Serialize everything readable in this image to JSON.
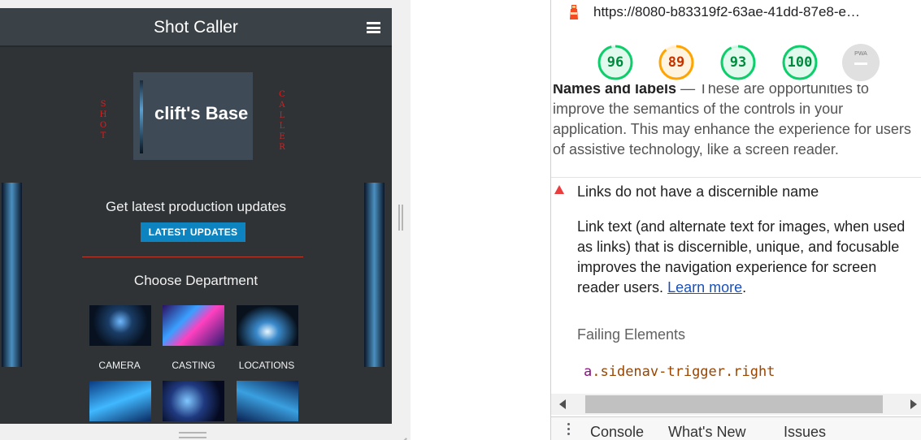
{
  "app": {
    "title": "Shot Caller",
    "vertical_left": [
      "S",
      "H",
      "O",
      "T"
    ],
    "vertical_right": [
      "C",
      "A",
      "L",
      "L",
      "E",
      "R"
    ],
    "base_title": "clift's Base",
    "latest_text": "Get latest production updates",
    "latest_button": "LATEST UPDATES",
    "choose_text": "Choose Department",
    "departments": [
      "CAMERA",
      "CASTING",
      "LOCATIONS"
    ]
  },
  "devtools": {
    "url": "https://8080-b83319f2-63ae-41dd-87e8-e…",
    "scores": [
      {
        "value": "96",
        "color": "#0cce6b",
        "text_color": "#008a3e",
        "fill": 0.96
      },
      {
        "value": "89",
        "color": "#ffa400",
        "text_color": "#c33300",
        "fill": 0.89
      },
      {
        "value": "93",
        "color": "#0cce6b",
        "text_color": "#008a3e",
        "fill": 0.93
      },
      {
        "value": "100",
        "color": "#0cce6b",
        "text_color": "#008a3e",
        "fill": 1.0
      }
    ],
    "pwa_label": "PWA",
    "section_title": "Names and labels",
    "section_rest": " — These are opportunities to improve the semantics of the controls in your application. This may enhance the experience for users of assistive technology, like a screen reader.",
    "audit_title": "Links do not have a discernible name",
    "audit_desc": "Link text (and alternate text for images, when used as links) that is discernible, unique, and focusable improves the navigation experience for screen reader users. ",
    "learn_more": "Learn more",
    "learn_more_suffix": ".",
    "failing_label": "Failing Elements",
    "failing_tag": "a",
    "failing_selector": ".sidenav-trigger.right",
    "drawer_tabs": [
      "Console",
      "What's New",
      "Issues"
    ]
  }
}
